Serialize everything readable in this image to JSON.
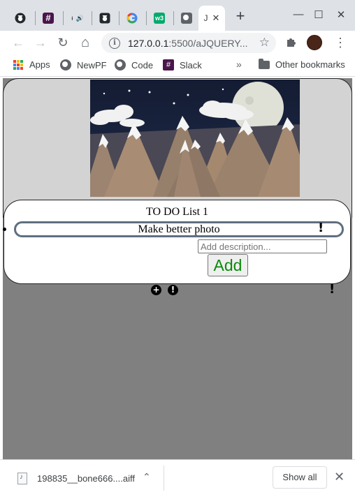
{
  "browser": {
    "tabs": [
      {
        "icon": "github-icon"
      },
      {
        "icon": "slack-icon"
      },
      {
        "icon": "audio-tab-icon",
        "title": "ᵻ",
        "sound": "🔊"
      },
      {
        "icon": "github-icon"
      },
      {
        "icon": "google-icon"
      },
      {
        "icon": "w3schools-icon",
        "label": "w3"
      },
      {
        "icon": "globe-icon"
      },
      {
        "icon": "page-icon",
        "title": "J",
        "close": "✕",
        "active": true
      }
    ],
    "new_tab": "+",
    "window_controls": {
      "minimize": "—",
      "maximize": "☐",
      "close": "✕"
    },
    "toolbar": {
      "back": "←",
      "forward": "→",
      "reload": "↻",
      "home": "⌂",
      "url_host": "127.0.0.1",
      "url_path": ":5500/aJQUERY...",
      "star": "☆",
      "extensions": "✚",
      "menu": "⋮"
    },
    "bookmarks": [
      {
        "label": "Apps",
        "icon": "apps-grid-icon"
      },
      {
        "label": "NewPF",
        "icon": "globe-icon"
      },
      {
        "label": "Code",
        "icon": "globe-icon"
      },
      {
        "label": "Slack",
        "icon": "slack-icon"
      }
    ],
    "bookmarks_overflow": "»",
    "other_bookmarks": "Other bookmarks"
  },
  "page": {
    "list_title": "TO DO List 1",
    "task_value": "Make better photo",
    "task_flag": "!",
    "description_placeholder": "Add description...",
    "add_label": "Add",
    "add_color": "#0a8a0a",
    "plus_button": "+",
    "alert_button": "!",
    "side_flag": "!"
  },
  "download_shelf": {
    "file_name": "198835__bone666....aiff",
    "chevron": "⌃",
    "show_all": "Show all",
    "close": "✕"
  }
}
